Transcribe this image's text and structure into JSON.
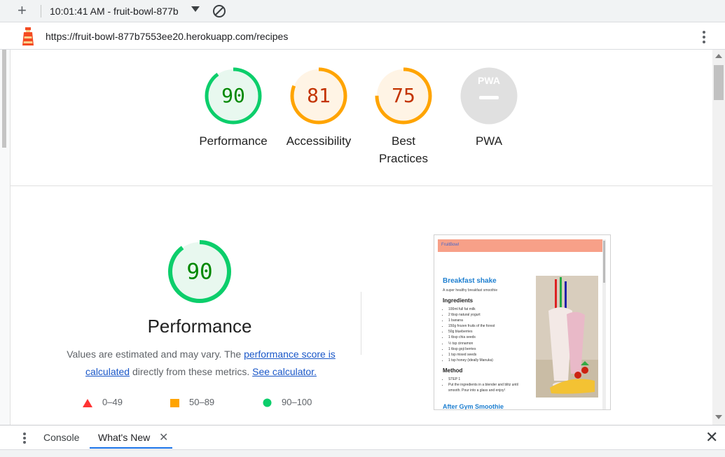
{
  "toolbar": {
    "new_icon": "plus-icon",
    "session_label": "10:01:41 AM - fruit-bowl-877b",
    "dropdown_icon": "caret-down-icon",
    "clear_icon": "block-icon"
  },
  "address": {
    "icon": "lighthouse-icon",
    "url": "https://fruit-bowl-877b7553ee20.herokuapp.com/recipes",
    "menu_icon": "more-vert-icon"
  },
  "categories": [
    {
      "score": "90",
      "value": 90,
      "label_lines": [
        "Performance"
      ],
      "status": "pass"
    },
    {
      "score": "81",
      "value": 81,
      "label_lines": [
        "Accessibility"
      ],
      "status": "average"
    },
    {
      "score": "75",
      "value": 75,
      "label_lines": [
        "Best",
        "Practices"
      ],
      "status": "average"
    },
    {
      "score": "PWA",
      "value": null,
      "label_lines": [
        "PWA"
      ],
      "status": "na"
    }
  ],
  "performance": {
    "score": "90",
    "value": 90,
    "title": "Performance",
    "desc_pre": "Values are estimated and may vary. The ",
    "link1": "performance score is calculated",
    "desc_mid": " directly from these metrics. ",
    "link2": "See calculator."
  },
  "legend": [
    {
      "icon": "triangle-icon",
      "range": "0–49"
    },
    {
      "icon": "square-icon",
      "range": "50–89"
    },
    {
      "icon": "circle-icon",
      "range": "90–100"
    }
  ],
  "screenshot": {
    "brand": "FruitBowl",
    "title": "Breakfast shake",
    "subtitle": "A super healthy breakfast smoothie",
    "ingredients_heading": "Ingredients",
    "ingredients": [
      "100ml full fat milk",
      "2 tbsp natural yogurt",
      "1 banana",
      "150g frozen fruits of the forest",
      "50g blueberries",
      "1 tbsp chia seeds",
      "½ tsp cinnamon",
      "1 tbsp goji berries",
      "1 tsp mixed seeds",
      "1 tsp honey (ideally Manuka)"
    ],
    "method_heading": "Method",
    "method": [
      "STEP 1",
      "Put the ingredients in a blender and blitz until smooth. Pour into a glass and enjoy!"
    ],
    "next_title": "After Gym Smoothie"
  },
  "drawer": {
    "menu_icon": "more-vert-icon",
    "tabs": [
      "Console",
      "What's New"
    ],
    "close_tab_icon": "close-icon",
    "close_icon": "close-icon"
  },
  "colors": {
    "pass": "#0cce6b",
    "pass_text": "#008800",
    "pass_bg": "#e8f8ef",
    "average": "#ffa400",
    "average_text": "#c33300",
    "average_bg": "#fff4e5",
    "fail": "#ff3333",
    "na": "#9e9e9e",
    "na_bg": "#e0e0e0",
    "link": "#1a57c8"
  }
}
